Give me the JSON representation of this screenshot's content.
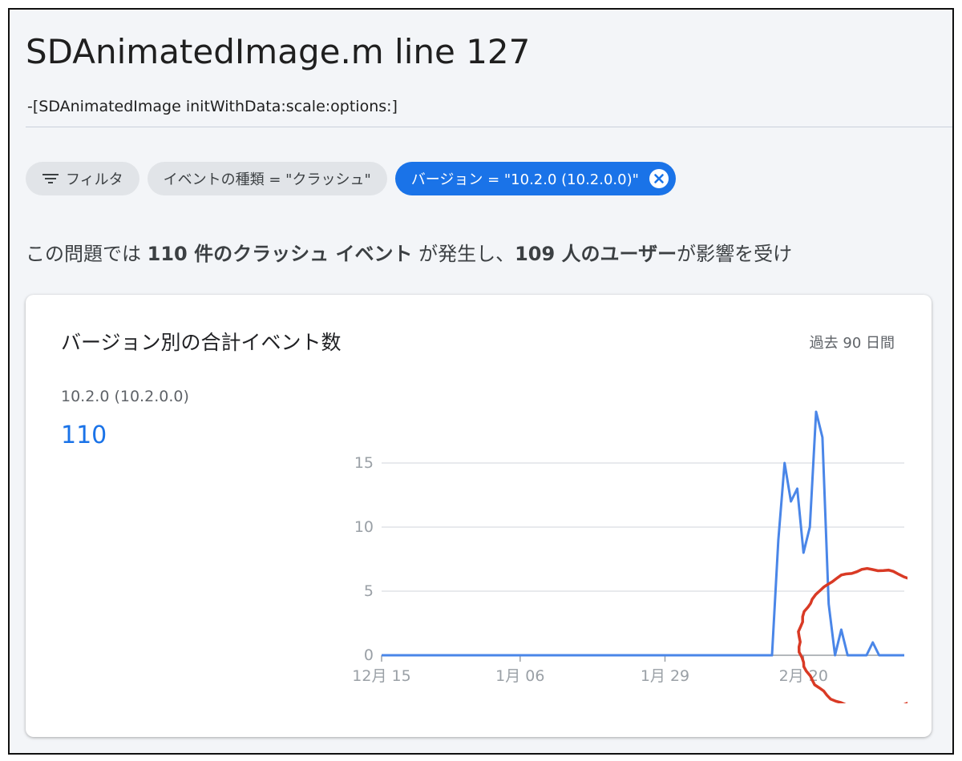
{
  "header": {
    "title": "SDAnimatedImage.m line 127",
    "subtitle": "-[SDAnimatedImage initWithData:scale:options:]"
  },
  "filters": {
    "filter_label": "フィルタ",
    "filter_icon": "filter-list-icon",
    "event_type_chip": "イベントの種類 = \"クラッシュ\"",
    "version_chip": "バージョン = \"10.2.0 (10.2.0.0)\"",
    "version_chip_close_icon": "close-circle-icon",
    "accent_color": "#1a73e8"
  },
  "summary": {
    "prefix": "この問題では ",
    "event_count": "110 件のクラッシュ イベント",
    "middle": " が発生し、",
    "user_count": "109 人のユーザー",
    "suffix": "が影響を受け"
  },
  "card": {
    "title": "バージョン別の合計イベント数",
    "range": "過去 90 日間",
    "series_name": "10.2.0 (10.2.0.0)",
    "series_total": "110"
  },
  "chart_data": {
    "type": "line",
    "line_color": "#4a86e8",
    "x_tick_labels": [
      "12月 15",
      "1月 06",
      "1月 29",
      "2月 20"
    ],
    "y_ticks": [
      0,
      5,
      10,
      15
    ],
    "ylim": [
      0,
      20
    ],
    "grid": true,
    "annotation": "red hand-drawn circle around the tail of the line after 2月 20",
    "series": [
      {
        "values": [
          0,
          0,
          0,
          0,
          0,
          0,
          0,
          0,
          0,
          0,
          0,
          0,
          0,
          0,
          0,
          0,
          0,
          0,
          0,
          0,
          0,
          0,
          0,
          0,
          0,
          0,
          0,
          0,
          0,
          0,
          0,
          0,
          0,
          0,
          0,
          0,
          0,
          0,
          0,
          0,
          0,
          0,
          0,
          0,
          0,
          0,
          0,
          0,
          0,
          0,
          0,
          0,
          0,
          0,
          0,
          0,
          0,
          0,
          0,
          0,
          0,
          0,
          0,
          9,
          15,
          12,
          13,
          8,
          10,
          19,
          17,
          4,
          0,
          2,
          0,
          0,
          0,
          0,
          1,
          0,
          0,
          0,
          0,
          0
        ]
      }
    ]
  }
}
